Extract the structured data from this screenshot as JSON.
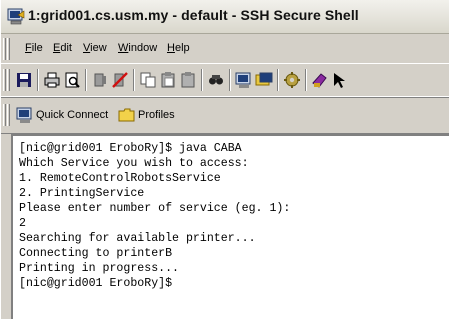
{
  "window": {
    "title": "1:grid001.cs.usm.my - default - SSH Secure Shell"
  },
  "menu": {
    "file": "File",
    "edit": "Edit",
    "view": "View",
    "window": "Window",
    "help": "Help"
  },
  "toolbar": {
    "icons": [
      "save-icon",
      "print-icon",
      "print-preview-icon",
      "disconnect-icon",
      "disconnect-red-icon",
      "copy-icon",
      "paste-icon",
      "paste-alt-icon",
      "find-icon",
      "quick-connect-icon",
      "profiles-icon",
      "settings-icon",
      "file-transfer-icon",
      "cursor-icon"
    ]
  },
  "profilebar": {
    "quick_connect": "Quick Connect",
    "profiles": "Profiles"
  },
  "terminal": {
    "lines": [
      "[nic@grid001 EroboRy]$ java CABA",
      "Which Service you wish to access:",
      "1. RemoteControlRobotsService",
      "2. PrintingService",
      "Please enter number of service (eg. 1):",
      "2",
      "Searching for available printer...",
      "Connecting to printerB",
      "Printing in progress...",
      "[nic@grid001 EroboRy]$"
    ]
  }
}
